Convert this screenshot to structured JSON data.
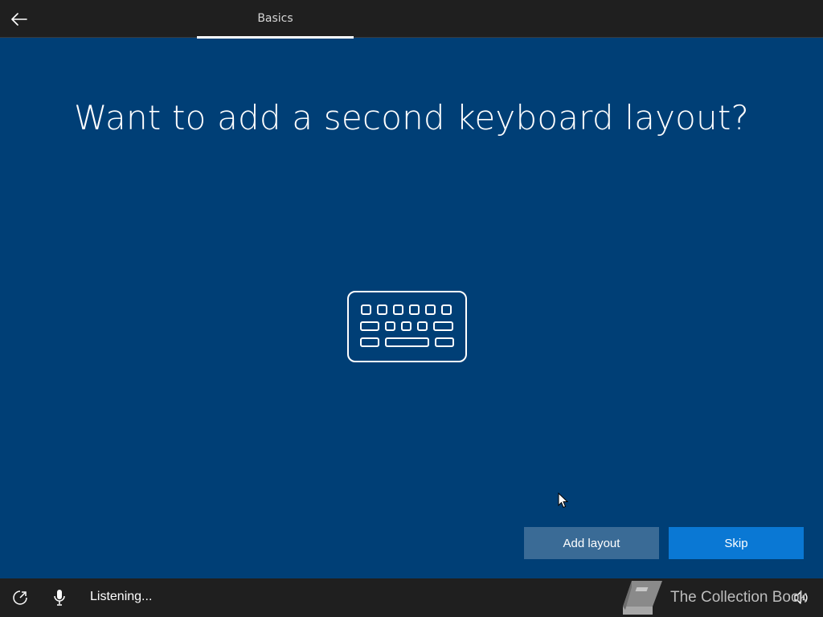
{
  "header": {
    "back_icon": "arrow-left-icon",
    "tab_label": "Basics"
  },
  "main": {
    "heading": "Want to add a second keyboard layout?",
    "illustration_icon": "keyboard-icon"
  },
  "actions": {
    "add_layout_label": "Add layout",
    "skip_label": "Skip"
  },
  "footer": {
    "ease_of_access_icon": "ease-of-access-icon",
    "mic_icon": "microphone-icon",
    "status_text": "Listening...",
    "volume_icon": "volume-icon"
  },
  "watermark": {
    "text": "The Collection Book",
    "icon": "book-icon"
  },
  "colors": {
    "background": "#003f76",
    "bar": "#1f1f1f",
    "primary_button": "#0a78d4",
    "secondary_button": "#3a6b96"
  }
}
